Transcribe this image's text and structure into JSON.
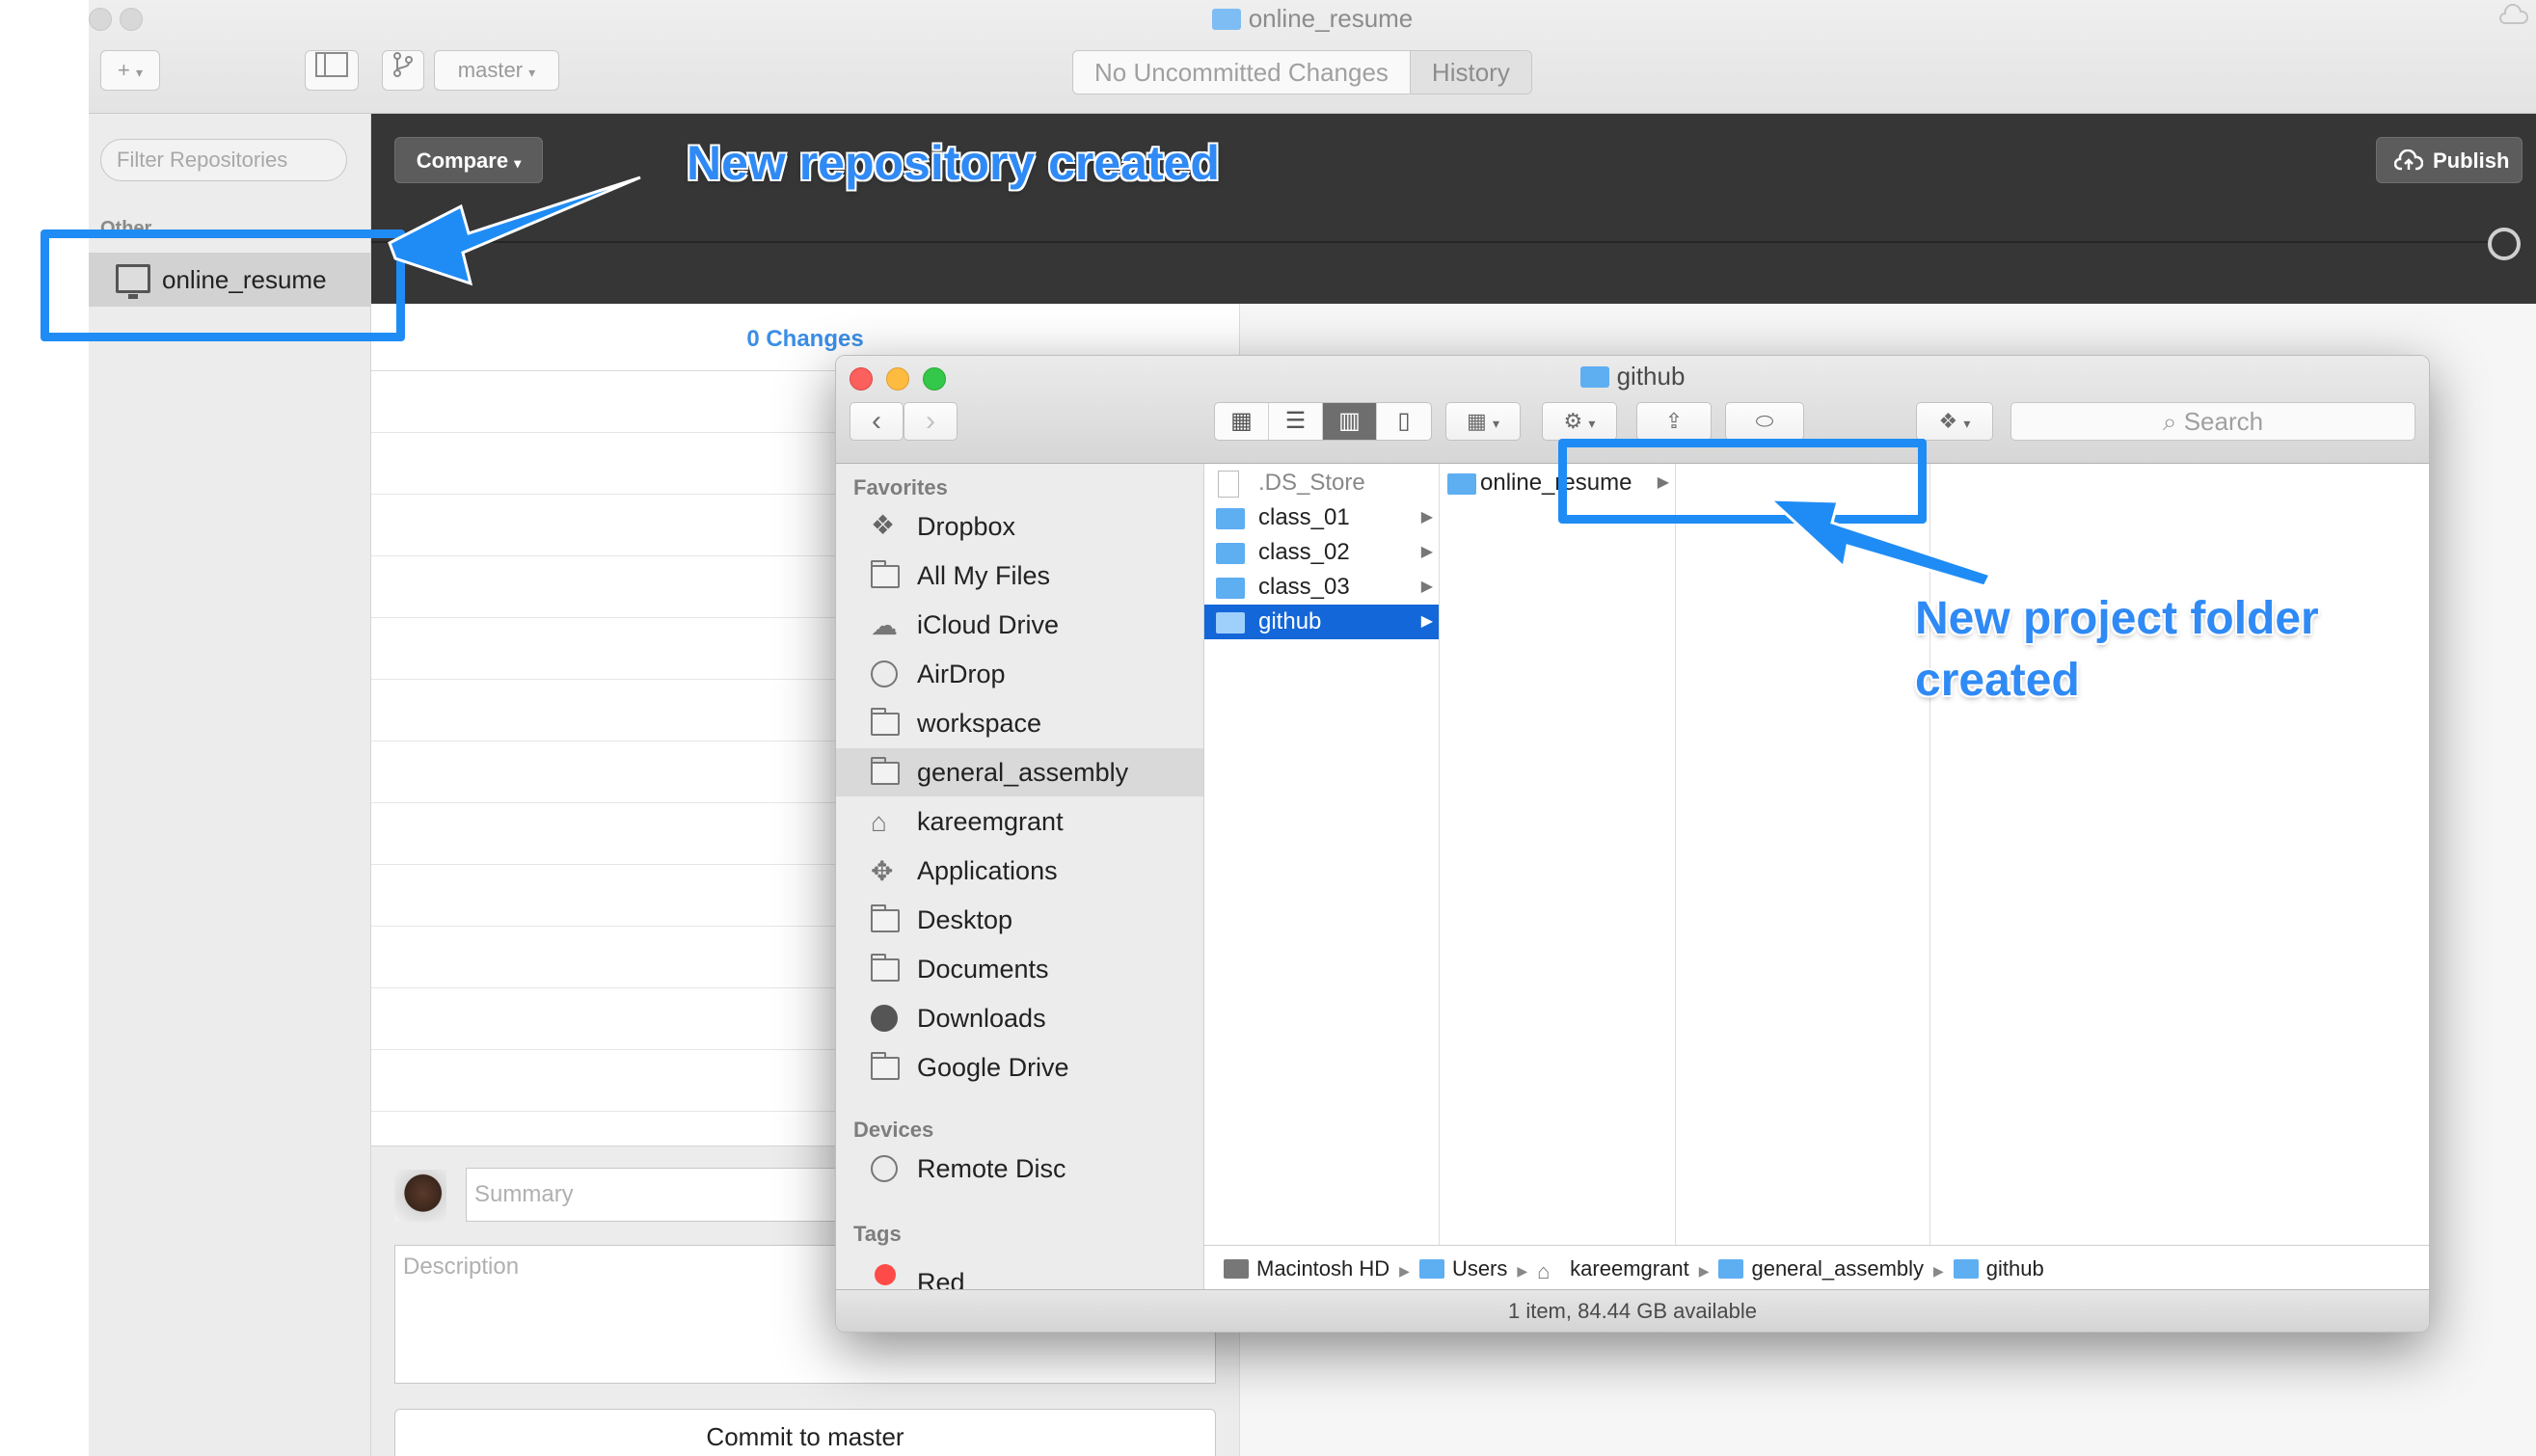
{
  "app": {
    "window_title": "online_resume",
    "branch": "master",
    "tabs": [
      "No Uncommitted Changes",
      "History"
    ],
    "filter_placeholder": "Filter Repositories",
    "other_label": "Other",
    "repo_name": "online_resume",
    "compare_label": "Compare",
    "publish_label": "Publish",
    "changes_label": "0 Changes",
    "summary_placeholder": "Summary",
    "description_placeholder": "Description",
    "commit_label": "Commit to master"
  },
  "finder": {
    "title": "github",
    "search_placeholder": "Search",
    "sidebar": {
      "favorites_header": "Favorites",
      "favorites": [
        {
          "label": "Dropbox",
          "icon": "dropbox-icon"
        },
        {
          "label": "All My Files",
          "icon": "all-my-files-icon"
        },
        {
          "label": "iCloud Drive",
          "icon": "cloud-icon"
        },
        {
          "label": "AirDrop",
          "icon": "airdrop-icon"
        },
        {
          "label": "workspace",
          "icon": "folder-icon"
        },
        {
          "label": "general_assembly",
          "icon": "folder-icon"
        },
        {
          "label": "kareemgrant",
          "icon": "home-icon"
        },
        {
          "label": "Applications",
          "icon": "applications-icon"
        },
        {
          "label": "Desktop",
          "icon": "desktop-icon"
        },
        {
          "label": "Documents",
          "icon": "documents-icon"
        },
        {
          "label": "Downloads",
          "icon": "downloads-icon"
        },
        {
          "label": "Google Drive",
          "icon": "folder-icon"
        }
      ],
      "devices_header": "Devices",
      "devices": [
        {
          "label": "Remote Disc",
          "icon": "disc-icon"
        }
      ],
      "tags_header": "Tags",
      "tags": [
        {
          "label": "Red",
          "color": "#ff4b47"
        }
      ]
    },
    "column1": [
      ".DS_Store",
      "class_01",
      "class_02",
      "class_03",
      "github"
    ],
    "column2": [
      "online_resume"
    ],
    "path": [
      "Macintosh HD",
      "Users",
      "kareemgrant",
      "general_assembly",
      "github"
    ],
    "status": "1 item, 84.44 GB available"
  },
  "annotations": {
    "repo_created": "New repository created",
    "folder_created_line1": "New project folder",
    "folder_created_line2": "created"
  },
  "colors": {
    "accent": "#1f8cf5",
    "selection": "#1467d8",
    "dark_bar": "#363636"
  }
}
